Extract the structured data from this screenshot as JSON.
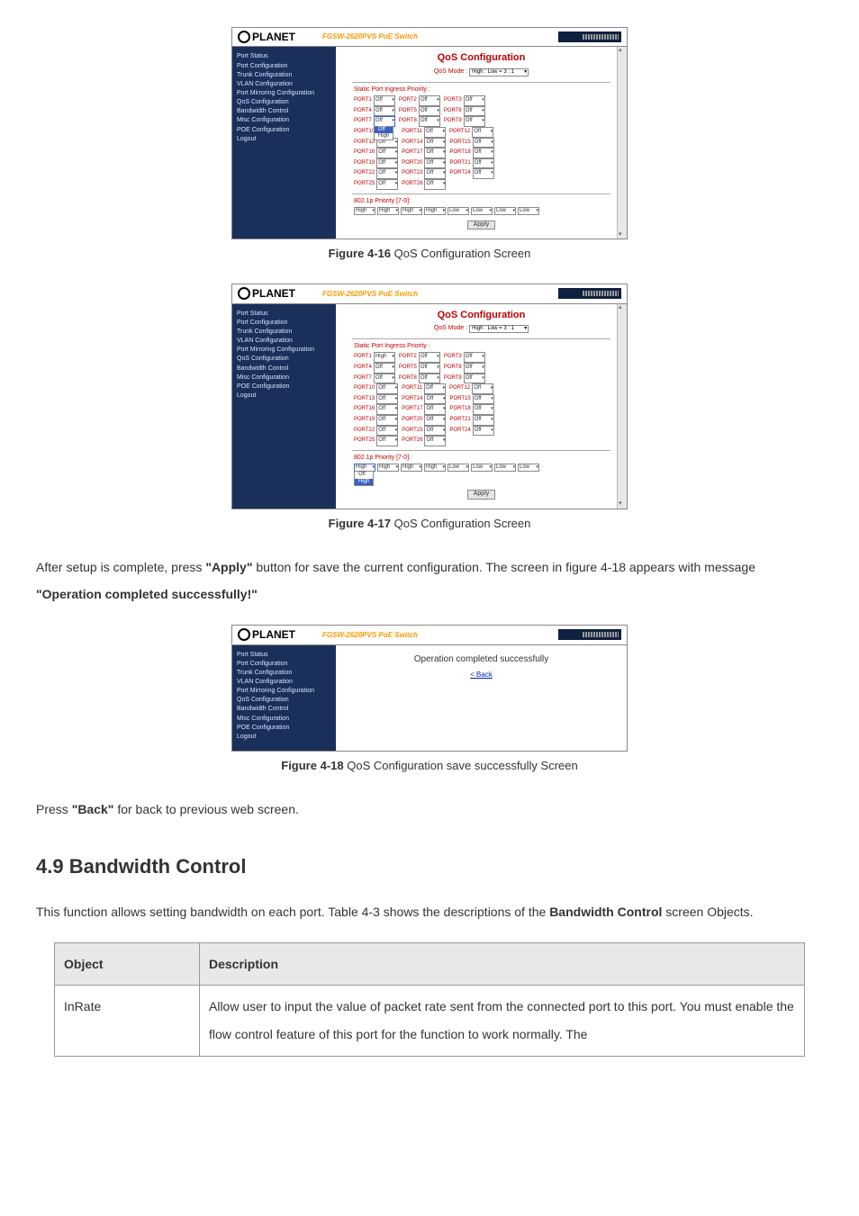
{
  "logo_text": "PLANET",
  "model": "FGSW-2620PVS PoE Switch",
  "sidebar": {
    "items": [
      "Port Status",
      "Port Configuration",
      "Trunk Configuration",
      "VLAN Configuration",
      "Port Mirroring Configuration",
      "QoS Configuration",
      "Bandwidth Control",
      "Misc Configuration",
      "POE Configuration",
      "Logout"
    ]
  },
  "qos": {
    "title": "QoS Configuration",
    "mode_label": "QoS Mode :",
    "mode_value": "High : Low = 3 : 1",
    "section_static": "Static Port Ingress Priority :",
    "port_labels": [
      "PORT1",
      "PORT2",
      "PORT3",
      "PORT4",
      "PORT5",
      "PORT6",
      "PORT7",
      "PORT8",
      "PORT9",
      "PORT10",
      "PORT11",
      "PORT12",
      "PORT13",
      "PORT14",
      "PORT15",
      "PORT16",
      "PORT17",
      "PORT18",
      "PORT19",
      "PORT20",
      "PORT21",
      "PORT22",
      "PORT23",
      "PORT24",
      "PORT25",
      "PORT26"
    ],
    "dd_off": "Off",
    "dd_high": "High",
    "section_8021p": "802.1p Priority [7-0]:",
    "prio_values": [
      "High",
      "High",
      "High",
      "High",
      "Low",
      "Low",
      "Low",
      "Low"
    ],
    "apply": "Apply",
    "open_dd_options_1": [
      "Off",
      "High"
    ],
    "open_dd_options_2": [
      "Off",
      "High"
    ]
  },
  "captions": {
    "fig16_b": "Figure 4-16",
    "fig16_t": " QoS Configuration Screen",
    "fig17_b": "Figure 4-17",
    "fig17_t": " QoS Configuration Screen",
    "fig18_b": "Figure 4-18",
    "fig18_t": " QoS Configuration save successfully Screen"
  },
  "para1_a": "After setup is complete, press ",
  "para1_b": "\"Apply\"",
  "para1_c": " button for save the current configuration. The screen in figure 4-18 appears with message ",
  "para1_d": "\"Operation completed successfully!\"",
  "success_msg": "Operation completed successfully",
  "back_link": "< Back",
  "para2_a": "Press ",
  "para2_b": "\"Back\"",
  "para2_c": " for back to previous web screen.",
  "heading49": "4.9 Bandwidth Control",
  "para3_a": "This function allows setting bandwidth on each port. Table 4-3 shows the descriptions of the ",
  "para3_b": "Bandwidth Control",
  "para3_c": " screen Objects.",
  "table": {
    "h1": "Object",
    "h2": "Description",
    "r1c1": "InRate",
    "r1c2": "Allow user to input the value of packet rate sent from the connected port to this port. You must enable the flow control feature of this port for the function to work normally. The"
  }
}
